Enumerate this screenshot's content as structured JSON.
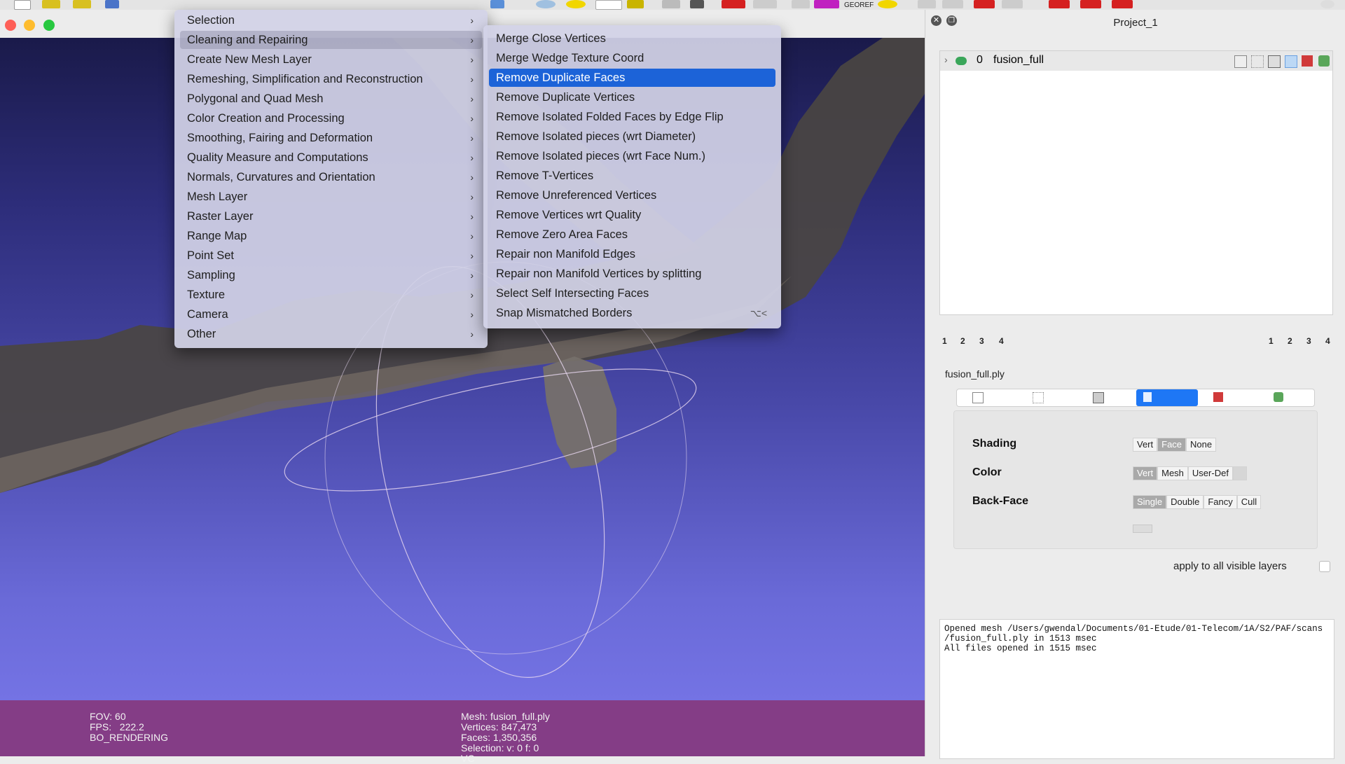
{
  "main_menu": {
    "items": [
      {
        "label": "Selection"
      },
      {
        "label": "Cleaning and Repairing"
      },
      {
        "label": "Create New Mesh Layer"
      },
      {
        "label": "Remeshing, Simplification and Reconstruction"
      },
      {
        "label": "Polygonal and Quad Mesh"
      },
      {
        "label": "Color Creation and Processing"
      },
      {
        "label": "Smoothing, Fairing and Deformation"
      },
      {
        "label": "Quality Measure and Computations"
      },
      {
        "label": "Normals, Curvatures and Orientation"
      },
      {
        "label": "Mesh Layer"
      },
      {
        "label": "Raster Layer"
      },
      {
        "label": "Range Map"
      },
      {
        "label": "Point Set"
      },
      {
        "label": "Sampling"
      },
      {
        "label": "Texture"
      },
      {
        "label": "Camera"
      },
      {
        "label": "Other"
      }
    ],
    "active_item": "Cleaning and Repairing",
    "arrow": "›"
  },
  "sub_menu": {
    "items": [
      {
        "label": "Merge Close Vertices"
      },
      {
        "label": "Merge Wedge Texture Coord"
      },
      {
        "label": "Remove Duplicate Faces"
      },
      {
        "label": "Remove Duplicate Vertices"
      },
      {
        "label": "Remove Isolated Folded Faces by Edge Flip"
      },
      {
        "label": "Remove Isolated pieces (wrt Diameter)"
      },
      {
        "label": "Remove Isolated pieces (wrt Face Num.)"
      },
      {
        "label": "Remove T-Vertices"
      },
      {
        "label": "Remove Unreferenced Vertices"
      },
      {
        "label": "Remove Vertices wrt Quality"
      },
      {
        "label": "Remove Zero Area Faces"
      },
      {
        "label": "Repair non Manifold Edges"
      },
      {
        "label": "Repair non Manifold Vertices by splitting"
      },
      {
        "label": "Select Self Intersecting Faces"
      },
      {
        "label": "Snap Mismatched Borders",
        "shortcut": "⌥<"
      }
    ],
    "selected_item": "Remove Duplicate Faces"
  },
  "toolbar": {
    "georef_label": "GEOREF"
  },
  "status_bar": {
    "left": [
      "FOV: 60",
      "FPS:   222.2",
      "BO_RENDERING"
    ],
    "right": [
      "Mesh: fusion_full.ply",
      "Vertices: 847,473",
      "Faces: 1,350,356",
      "Selection: v: 0 f: 0",
      "VC"
    ]
  },
  "project": {
    "title": "Project_1",
    "layer": {
      "index": "0",
      "name": "fusion_full"
    },
    "pages_left": [
      "1",
      "2",
      "3",
      "4"
    ],
    "pages_right": [
      "1",
      "2",
      "3",
      "4"
    ],
    "mesh_file": "fusion_full.ply",
    "render_modes": [
      "box-icon",
      "points-icon",
      "wireframe-icon",
      "solid-icon",
      "texture-icon",
      "smooth-icon"
    ],
    "selected_mode": "solid-icon"
  },
  "properties": {
    "shading": {
      "label": "Shading",
      "options": [
        "Vert",
        "Face",
        "None"
      ],
      "selected": "Face"
    },
    "color": {
      "label": "Color",
      "options": [
        "Vert",
        "Mesh",
        "User-Def"
      ],
      "selected": "Vert"
    },
    "backface": {
      "label": "Back-Face",
      "options": [
        "Single",
        "Double",
        "Fancy",
        "Cull"
      ],
      "selected": "Single"
    },
    "apply_all_label": "apply to all visible layers"
  },
  "log": {
    "lines": [
      "Opened mesh /Users/gwendal/Documents/01-Etude/01-Telecom/1A/S2/PAF/scans",
      "/fusion_full.ply in 1513 msec",
      "All files opened in 1515 msec"
    ]
  },
  "colors": {
    "accent": "#1c63d8",
    "status_bar": "#843d86",
    "viewport_top": "#1a1a4a",
    "viewport_bottom": "#7473e4"
  }
}
